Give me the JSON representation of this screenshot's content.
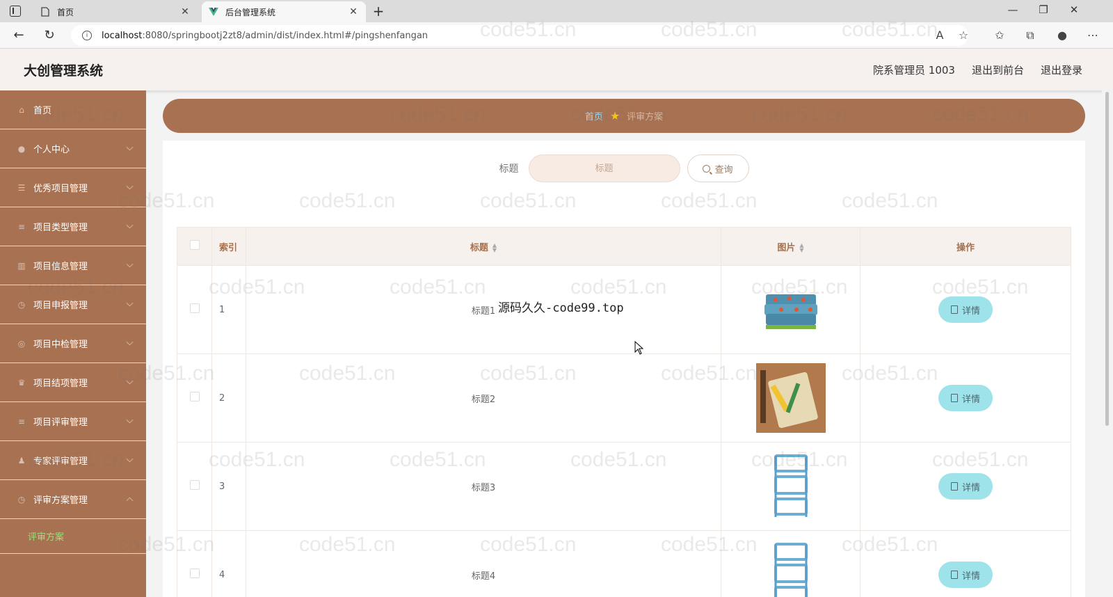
{
  "browser": {
    "tabs": [
      {
        "title": "首页",
        "active": false
      },
      {
        "title": "后台管理系统",
        "active": true
      }
    ],
    "url_host": "localhost",
    "url_rest": ":8080/springbootj2zt8/admin/dist/index.html#/pingshenfangan"
  },
  "header": {
    "title": "大创管理系统",
    "user": "院系管理员 1003",
    "front_link": "退出到前台",
    "logout_link": "退出登录"
  },
  "sidebar": {
    "items": [
      {
        "label": "首页",
        "icon": "home-icon"
      },
      {
        "label": "个人中心",
        "icon": "user-icon"
      },
      {
        "label": "优秀项目管理",
        "icon": "list-icon"
      },
      {
        "label": "项目类型管理",
        "icon": "menu-icon"
      },
      {
        "label": "项目信息管理",
        "icon": "chart-icon"
      },
      {
        "label": "项目申报管理",
        "icon": "clock-icon"
      },
      {
        "label": "项目中检管理",
        "icon": "globe-icon"
      },
      {
        "label": "项目结项管理",
        "icon": "trophy-icon"
      },
      {
        "label": "项目评审管理",
        "icon": "menu-icon"
      },
      {
        "label": "专家评审管理",
        "icon": "person-icon"
      },
      {
        "label": "评审方案管理",
        "icon": "clock-icon"
      }
    ],
    "sub_item": "评审方案"
  },
  "breadcrumb": {
    "home": "首页",
    "current": "评审方案"
  },
  "search": {
    "label": "标题",
    "placeholder": "标题",
    "button": "查询"
  },
  "table": {
    "columns": {
      "index": "索引",
      "title": "标题",
      "image": "图片",
      "operation": "操作"
    },
    "rows": [
      {
        "index": "1",
        "title": "标题1",
        "action": "详情",
        "image": "towel-stack"
      },
      {
        "index": "2",
        "title": "标题2",
        "action": "详情",
        "image": "craft-board"
      },
      {
        "index": "3",
        "title": "标题3",
        "action": "详情",
        "image": "blue-basket-rack"
      },
      {
        "index": "4",
        "title": "标题4",
        "action": "详情",
        "image": "blue-basket-rack"
      }
    ]
  },
  "overlay_text": "源码久久-code99.top",
  "watermark": "code51.cn",
  "colors": {
    "accent": "#a87152",
    "button": "#9fe3ea",
    "active_submenu": "#9be07a"
  }
}
